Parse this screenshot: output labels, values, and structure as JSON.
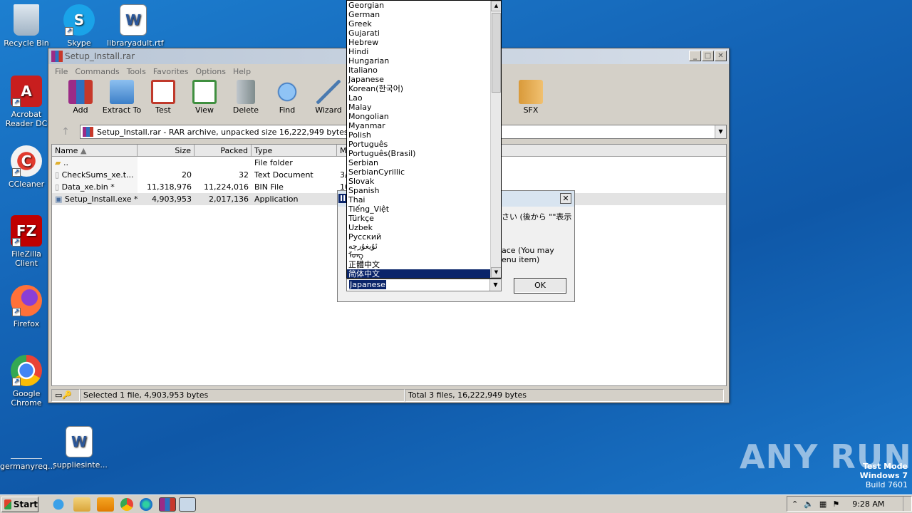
{
  "desktop": {
    "icons": [
      {
        "label": "Recycle Bin",
        "name": "recycle-bin-icon"
      },
      {
        "label": "Skype",
        "name": "skype-icon"
      },
      {
        "label": "libraryadult.rtf",
        "name": "word-doc-icon"
      },
      {
        "label": "Acrobat Reader DC",
        "name": "acrobat-icon"
      },
      {
        "label": "CCleaner",
        "name": "ccleaner-icon"
      },
      {
        "label": "FileZilla Client",
        "name": "filezilla-icon"
      },
      {
        "label": "Firefox",
        "name": "firefox-icon"
      },
      {
        "label": "Google Chrome",
        "name": "chrome-icon"
      },
      {
        "label": "germanyreq...",
        "name": "blank-file-icon"
      },
      {
        "label": "suppliesinte...",
        "name": "word-doc-icon"
      }
    ]
  },
  "winrar": {
    "title": "Setup_Install.rar",
    "menu": [
      "File",
      "Commands",
      "Tools",
      "Favorites",
      "Options",
      "Help"
    ],
    "toolbar": [
      {
        "label": "Add",
        "color": "#8a3b8f"
      },
      {
        "label": "Extract To",
        "color": "#4a8fd6"
      },
      {
        "label": "Test",
        "color": "#c0392b"
      },
      {
        "label": "View",
        "color": "#3f8f3f"
      },
      {
        "label": "Delete",
        "color": "#7f8c8d"
      },
      {
        "label": "Find",
        "color": "#2e6fbf"
      },
      {
        "label": "Wizard",
        "color": "#9ab8d8"
      },
      {
        "label": "SFX",
        "color": "#d99a3a"
      }
    ],
    "address": "Setup_Install.rar - RAR archive, unpacked size 16,222,949 bytes",
    "columns": [
      "Name",
      "Size",
      "Packed",
      "Type",
      "M"
    ],
    "files": [
      {
        "name": "..",
        "size": "",
        "packed": "",
        "type": "File folder",
        "m": ""
      },
      {
        "name": "CheckSums_xe.t...",
        "size": "20",
        "packed": "32",
        "type": "Text Document",
        "m": "3/"
      },
      {
        "name": "Data_xe.bin *",
        "size": "11,318,976",
        "packed": "11,224,016",
        "type": "BIN File",
        "m": "10"
      },
      {
        "name": "Setup_Install.exe *",
        "size": "4,903,953",
        "packed": "2,017,136",
        "type": "Application",
        "m": ""
      }
    ],
    "status_left": "Selected 1 file, 4,903,953 bytes",
    "status_right": "Total 3 files, 16,222,949 bytes"
  },
  "dialog": {
    "title_fragment": "II",
    "close": "✕",
    "text_line1": "さい (後から \"\"表示",
    "text_line2": "ace (You may",
    "text_line3": "enu item)",
    "ok": "OK",
    "combo_value": "Japanese"
  },
  "dropdown": {
    "items": [
      "Georgian",
      "German",
      "Greek",
      "Gujarati",
      "Hebrew",
      "Hindi",
      "Hungarian",
      "Italiano",
      "Japanese",
      "Korean(한국어)",
      "Lao",
      "Malay",
      "Mongolian",
      "Myanmar",
      "Polish",
      "Português",
      "Português(Brasil)",
      "Serbian",
      "SerbianCyrillic",
      "Slovak",
      "Spanish",
      "Thai",
      "Tiếng_Việt",
      "Türkçe",
      "Uzbek",
      "Русский",
      "ئۇيغۇرچە",
      "ᠮᠣᠩ",
      "正體中文",
      "简体中文"
    ],
    "selected": "简体中文"
  },
  "taskbar": {
    "start": "Start",
    "time": "9:28 AM"
  },
  "watermark": "ANY RUN",
  "testmode": {
    "line1": "Test Mode",
    "line2": "Windows 7",
    "line3": "Build 7601"
  }
}
